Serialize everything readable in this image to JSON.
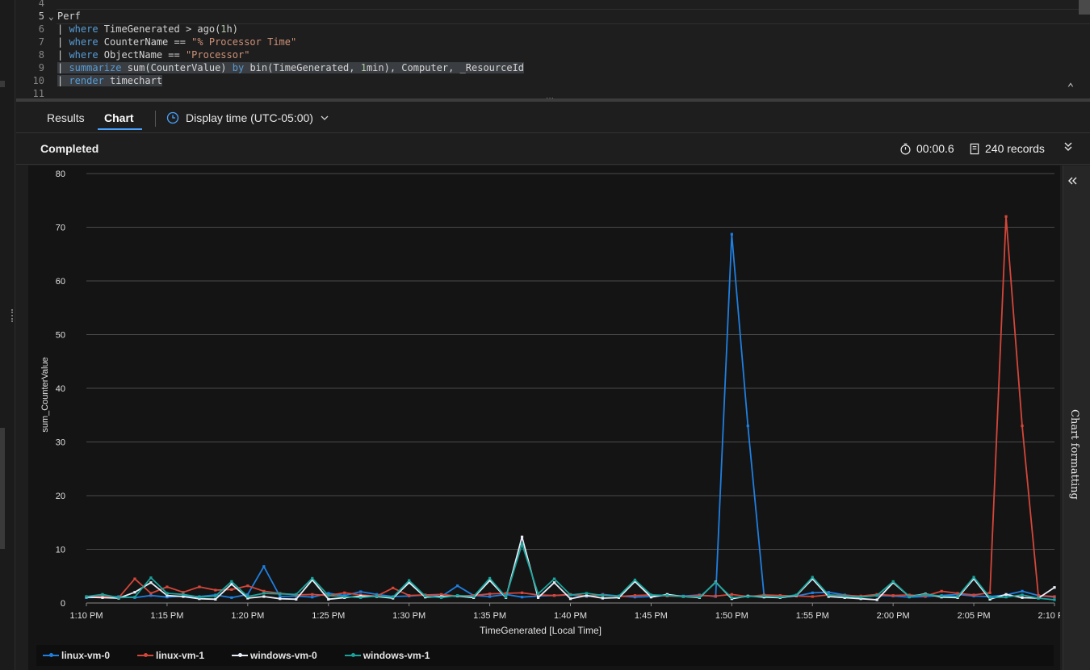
{
  "editor": {
    "lines": [
      {
        "n": "4",
        "tokens": []
      },
      {
        "n": "5",
        "tokens": [
          {
            "t": "Perf",
            "c": "id"
          }
        ]
      },
      {
        "n": "6",
        "tokens": [
          {
            "t": "| ",
            "c": "op"
          },
          {
            "t": "where",
            "c": "kw"
          },
          {
            "t": " TimeGenerated > ago(",
            "c": "id"
          },
          {
            "t": "1",
            "c": "num"
          },
          {
            "t": "h)",
            "c": "id"
          }
        ]
      },
      {
        "n": "7",
        "tokens": [
          {
            "t": "| ",
            "c": "op"
          },
          {
            "t": "where",
            "c": "kw"
          },
          {
            "t": " CounterName == ",
            "c": "id"
          },
          {
            "t": "\"% Processor Time\"",
            "c": "str"
          }
        ]
      },
      {
        "n": "8",
        "tokens": [
          {
            "t": "| ",
            "c": "op"
          },
          {
            "t": "where",
            "c": "kw"
          },
          {
            "t": " ObjectName == ",
            "c": "id"
          },
          {
            "t": "\"Processor\"",
            "c": "str"
          }
        ]
      },
      {
        "n": "9",
        "tokens": [
          {
            "t": "| ",
            "c": "op"
          },
          {
            "t": "summarize",
            "c": "kw"
          },
          {
            "t": " sum(CounterValue) ",
            "c": "id"
          },
          {
            "t": "by",
            "c": "kw"
          },
          {
            "t": " bin(TimeGenerated, ",
            "c": "id"
          },
          {
            "t": "1",
            "c": "num"
          },
          {
            "t": "min), Computer, _ResourceId",
            "c": "id"
          }
        ]
      },
      {
        "n": "10",
        "tokens": [
          {
            "t": "| ",
            "c": "op"
          },
          {
            "t": "render",
            "c": "kw"
          },
          {
            "t": " timechart",
            "c": "id"
          }
        ]
      },
      {
        "n": "11",
        "tokens": []
      }
    ]
  },
  "tabs": {
    "results": "Results",
    "chart": "Chart"
  },
  "display_time": "Display time (UTC-05:00)",
  "status": {
    "text": "Completed",
    "duration": "00:00.6",
    "records": "240 records"
  },
  "side_panel": {
    "label": "Chart formatting"
  },
  "icons": {
    "fold": "chevron-down-icon",
    "collapse_editor": "double-chevron-up-icon",
    "clock": "clock-icon",
    "stopwatch": "stopwatch-icon",
    "records": "records-icon",
    "expand": "double-chevron-down-icon",
    "side_collapse": "double-chevron-left-icon"
  },
  "chart_data": {
    "type": "line",
    "xlabel": "TimeGenerated [Local Time]",
    "ylabel": "sum_CounterValue",
    "ylim": [
      0,
      80
    ],
    "yticks": [
      0,
      10,
      20,
      30,
      40,
      50,
      60,
      70,
      80
    ],
    "xlim": [
      "1:10 PM",
      "2:10 PM"
    ],
    "x_start_minutes": 70,
    "xticks": [
      "1:10 PM",
      "1:15 PM",
      "1:20 PM",
      "1:25 PM",
      "1:30 PM",
      "1:35 PM",
      "1:40 PM",
      "1:45 PM",
      "1:50 PM",
      "1:55 PM",
      "2:00 PM",
      "2:05 PM",
      "2:10 PM"
    ],
    "grid": true,
    "legend_position": "bottom",
    "series": [
      {
        "name": "linux-vm-0",
        "color": "#1f7fe0",
        "values": [
          1.0,
          1.1,
          1.2,
          1.0,
          1.4,
          1.1,
          1.3,
          1.2,
          1.5,
          1.0,
          1.6,
          6.8,
          1.2,
          1.3,
          1.1,
          1.8,
          1.4,
          2.1,
          1.6,
          1.2,
          1.3,
          1.5,
          1.2,
          3.2,
          1.4,
          1.2,
          1.6,
          1.1,
          1.3,
          1.4,
          1.5,
          1.2,
          1.6,
          1.3,
          1.1,
          1.2,
          1.4,
          1.3,
          1.5,
          1.2,
          68.7,
          33.0,
          1.4,
          1.1,
          1.3,
          1.9,
          2.0,
          1.5,
          1.2,
          1.4,
          1.3,
          1.1,
          1.2,
          1.4,
          1.6,
          1.3,
          1.2,
          1.5,
          2.2,
          1.4,
          1.1
        ]
      },
      {
        "name": "linux-vm-1",
        "color": "#d4463a",
        "values": [
          1.2,
          1.3,
          1.0,
          4.5,
          1.8,
          3.0,
          2.0,
          3.0,
          2.4,
          2.5,
          3.2,
          2.2,
          1.8,
          1.5,
          1.6,
          1.4,
          1.9,
          1.5,
          1.3,
          2.8,
          1.4,
          1.5,
          1.6,
          1.3,
          1.4,
          1.7,
          1.8,
          1.9,
          1.5,
          1.4,
          1.6,
          1.3,
          1.5,
          1.2,
          1.4,
          1.5,
          1.3,
          1.2,
          1.4,
          1.3,
          1.6,
          1.2,
          1.5,
          1.4,
          1.3,
          1.2,
          1.5,
          1.4,
          1.3,
          1.6,
          1.4,
          1.5,
          1.3,
          2.2,
          1.8,
          1.5,
          1.9,
          72.0,
          33.0,
          1.4,
          1.2
        ]
      },
      {
        "name": "windows-vm-0",
        "color": "#e8eef8",
        "values": [
          1.1,
          1.0,
          0.9,
          2.0,
          3.8,
          1.4,
          1.2,
          0.8,
          0.7,
          3.5,
          0.9,
          1.2,
          0.8,
          0.7,
          4.3,
          0.7,
          1.0,
          1.3,
          1.2,
          0.9,
          3.8,
          1.1,
          1.2,
          1.3,
          1.0,
          4.2,
          1.0,
          12.3,
          1.0,
          3.8,
          0.8,
          1.4,
          0.9,
          1.0,
          4.0,
          1.1,
          1.6,
          1.2,
          1.0,
          3.9,
          0.8,
          1.3,
          1.1,
          1.0,
          1.4,
          4.5,
          1.2,
          1.0,
          0.8,
          0.6,
          3.8,
          1.2,
          1.7,
          1.1,
          1.0,
          4.5,
          0.7,
          1.6,
          1.0,
          0.9,
          2.9
        ]
      },
      {
        "name": "windows-vm-1",
        "color": "#19a39c",
        "values": [
          1.2,
          1.6,
          1.0,
          1.1,
          4.7,
          1.8,
          1.6,
          1.1,
          1.3,
          4.0,
          1.2,
          1.8,
          1.7,
          1.6,
          4.6,
          1.4,
          1.2,
          1.0,
          1.3,
          1.1,
          4.2,
          1.3,
          1.0,
          1.4,
          1.2,
          4.6,
          1.1,
          11.0,
          1.7,
          4.5,
          1.5,
          1.8,
          1.4,
          1.3,
          4.3,
          1.5,
          1.4,
          1.2,
          1.1,
          3.8,
          1.0,
          1.2,
          1.3,
          1.1,
          1.5,
          4.8,
          1.5,
          1.3,
          1.1,
          1.4,
          4.0,
          1.2,
          1.6,
          1.3,
          1.2,
          4.8,
          1.0,
          1.1,
          1.5,
          0.9,
          0.6
        ]
      }
    ]
  }
}
